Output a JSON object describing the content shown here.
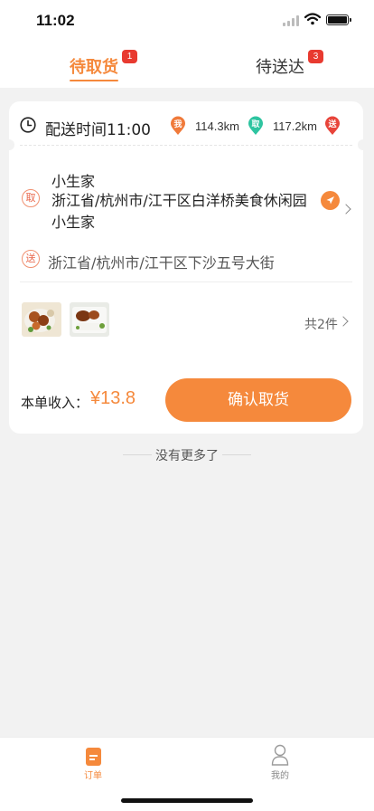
{
  "status_bar": {
    "time": "11:02"
  },
  "tabs": [
    {
      "label": "待取货",
      "badge": "1"
    },
    {
      "label": "待送达",
      "badge": "3"
    }
  ],
  "order": {
    "delivery_time": "配送时间11:00",
    "route": [
      {
        "marker": "我",
        "color": "#f07a3a"
      },
      {
        "distance": "114.3km"
      },
      {
        "marker": "取",
        "color": "#2ec4a0"
      },
      {
        "distance": "117.2km"
      },
      {
        "marker": "送",
        "color": "#e8443a"
      }
    ],
    "pickup": {
      "label": "取",
      "shop_name": "小生家",
      "address": "浙江省/杭州市/江干区白洋桥美食休闲园小生家"
    },
    "delivery": {
      "label": "送",
      "address": "浙江省/杭州市/江干区下沙五号大街"
    },
    "item_count": "共2件",
    "income_label": "本单收入：",
    "income_value": "¥13.8",
    "confirm_button": "确认取货"
  },
  "list_end_text": "没有更多了",
  "bottom_nav": [
    {
      "label": "订单",
      "icon": "orders-icon",
      "active": true
    },
    {
      "label": "我的",
      "icon": "profile-icon",
      "active": false
    }
  ],
  "colors": {
    "accent": "#f5893c",
    "badge": "#e83a30",
    "background": "#f2f2f2"
  }
}
